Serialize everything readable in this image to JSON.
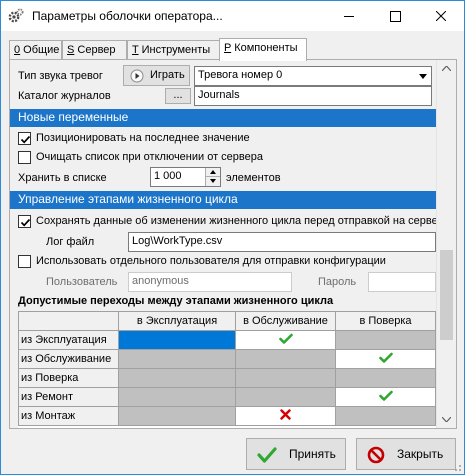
{
  "window": {
    "title": "Параметры оболочки оператора..."
  },
  "tabs": [
    {
      "key": "0",
      "label": " Общие"
    },
    {
      "key": "S",
      "label": " Сервер"
    },
    {
      "key": "T",
      "label": " Инструменты"
    },
    {
      "key": "P",
      "label": " Компоненты"
    }
  ],
  "alarm": {
    "label": "Тип звука тревог",
    "play_button": "Играть",
    "sound_value": "Тревога номер 0"
  },
  "journals": {
    "label": "Каталог журналов",
    "browse_button": "...",
    "value": "Journals"
  },
  "new_vars": {
    "header": "Новые переменные",
    "position_last": "Позиционировать на последнее значение",
    "clear_on_disconnect": "Очищать список при отключении от сервера",
    "keep_label": "Хранить в списке",
    "keep_value": "1 000",
    "keep_suffix": "элементов"
  },
  "lifecycle": {
    "header": "Управление этапами жизненного цикла",
    "save_changes": "Сохранять данные об изменении жизненного цикла перед отправкой на серве",
    "log_label": "Лог файл",
    "log_value": "Log\\WorkType.csv",
    "use_separate_user": "Использовать отдельного пользователя для отправки конфигурации",
    "user_label": "Пользователь",
    "user_value": "anonymous",
    "password_label": "Пароль",
    "password_value": ""
  },
  "transitions": {
    "title": "Допустимые переходы между этапами жизненного цикла",
    "columns": [
      "в Эксплуатация",
      "в Обслуживание",
      "в Поверка"
    ],
    "rows": [
      {
        "label": "из Эксплуатация",
        "cells": [
          "blue",
          "check",
          "gray"
        ]
      },
      {
        "label": "из Обслуживание",
        "cells": [
          "gray",
          "gray",
          "check"
        ]
      },
      {
        "label": "из Поверка",
        "cells": [
          "gray",
          "gray",
          "gray"
        ]
      },
      {
        "label": "из Ремонт",
        "cells": [
          "gray",
          "gray",
          "check"
        ]
      },
      {
        "label": "из Монтаж",
        "cells": [
          "gray",
          "cross",
          "gray"
        ]
      }
    ]
  },
  "buttons": {
    "accept": "Принять",
    "close": "Закрыть"
  },
  "colors": {
    "section_header": "#1c75c9",
    "selected_cell": "#0078d7",
    "disabled_cell": "#c0c0c0",
    "check": "#2fa82f",
    "cross": "#d40000"
  }
}
